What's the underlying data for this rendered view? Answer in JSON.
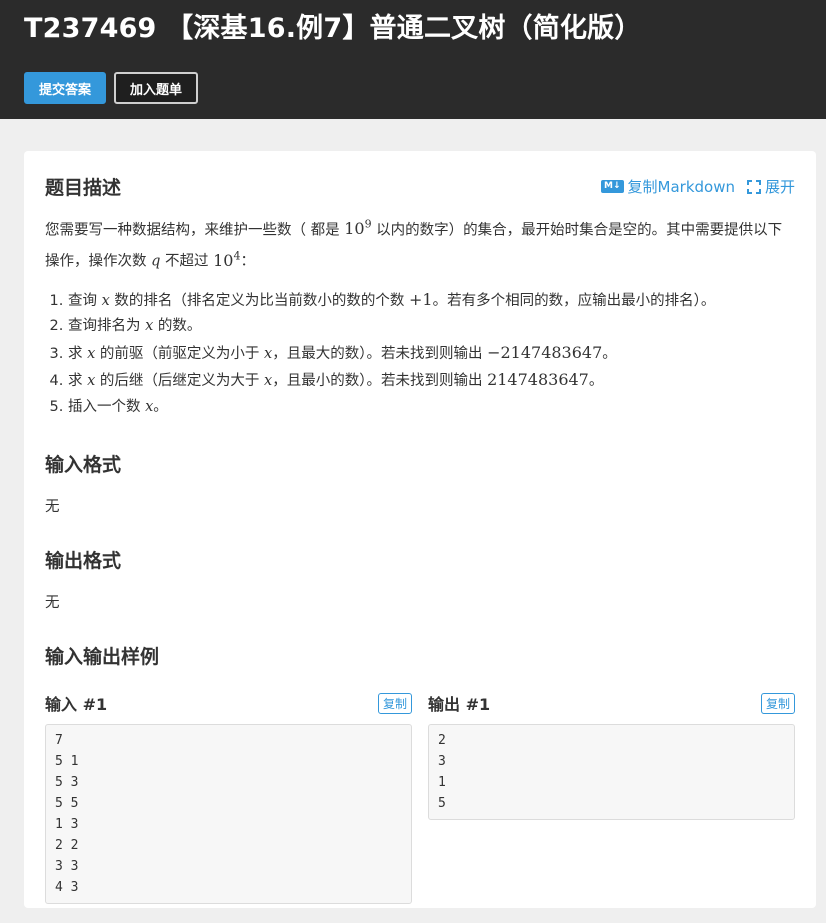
{
  "page": {
    "title": "T237469 【深基16.例7】普通二叉树（简化版）",
    "buttons": {
      "submit": "提交答案",
      "add_list": "加入题单"
    }
  },
  "problem": {
    "desc_heading": "题目描述",
    "tools": {
      "copy_markdown": "复制Markdown",
      "md_badge": "M↓",
      "expand": "展开"
    },
    "desc_p1": "您需要写一种数据结构，来维护一些数（ 都是 ",
    "desc_pow1_base": "10",
    "desc_pow1_exp": "9",
    "desc_p2": " 以内的数字）的集合，最开始时集合是空的。其中需要提供以下操作，操作次数 ",
    "desc_q": "q",
    "desc_p3": " 不超过 ",
    "desc_pow2_base": "10",
    "desc_pow2_exp": "4",
    "desc_p4": "：",
    "ops": [
      {
        "a": "查询 ",
        "var": "x",
        "b": " 数的排名（排名定义为比当前数小的数的个数 ",
        "num": "+1",
        "c": "。若有多个相同的数，应输出最小的排名）。"
      },
      {
        "a": "查询排名为 ",
        "var": "x",
        "b": " 的数。",
        "num": "",
        "c": ""
      },
      {
        "a": "求 ",
        "var": "x",
        "b": " 的前驱（前驱定义为小于 ",
        "var2": "x",
        "b2": "，且最大的数）。若未找到则输出 ",
        "num": "−2147483647",
        "c": "。"
      },
      {
        "a": "求 ",
        "var": "x",
        "b": " 的后继（后继定义为大于 ",
        "var2": "x",
        "b2": "，且最小的数）。若未找到则输出 ",
        "num": "2147483647",
        "c": "。"
      },
      {
        "a": "插入一个数 ",
        "var": "x",
        "b": "。",
        "num": "",
        "c": ""
      }
    ],
    "input_heading": "输入格式",
    "input_text": "无",
    "output_heading": "输出格式",
    "output_text": "无",
    "samples_heading": "输入输出样例",
    "sample_in_label": "输入 #1",
    "sample_out_label": "输出 #1",
    "copy_label": "复制",
    "sample_in": "7\n5 1\n5 3\n5 5\n1 3\n2 2\n3 3\n4 3",
    "sample_out": "2\n3\n1\n5"
  },
  "colors": {
    "accent": "#3498db",
    "header_bg": "#2b2b2b",
    "page_bg": "#efefef"
  }
}
